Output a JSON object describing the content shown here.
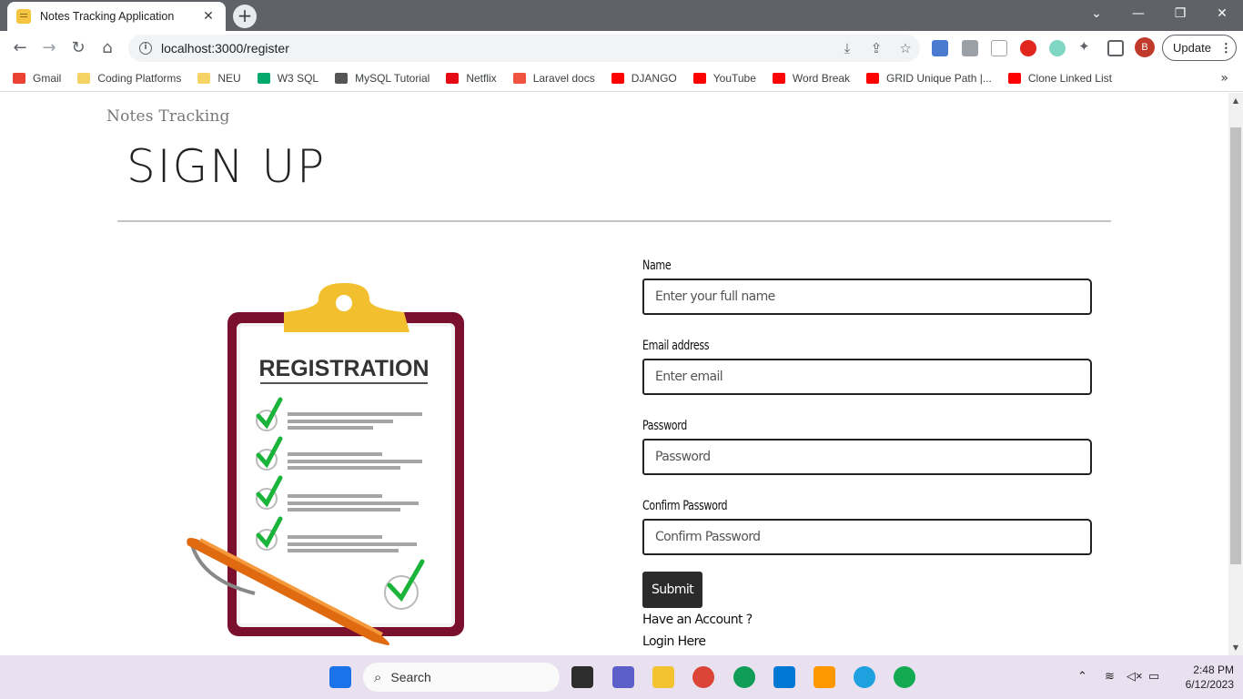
{
  "browser": {
    "tab_title": "Notes Tracking Application",
    "tab_close": "✕",
    "new_tab": "+",
    "url": "localhost:3000/register",
    "update_label": "Update",
    "profile_initial": "B",
    "bookmarks": [
      {
        "label": "Gmail",
        "icon": "gmail-icon",
        "color": "#ea4335"
      },
      {
        "label": "Coding Platforms",
        "icon": "folder-icon",
        "color": "#f6d365"
      },
      {
        "label": "NEU",
        "icon": "folder-icon",
        "color": "#f6d365"
      },
      {
        "label": "W3 SQL",
        "icon": "w3schools-icon",
        "color": "#04aa6d"
      },
      {
        "label": "MySQL Tutorial",
        "icon": "mysql-icon",
        "color": "#555555"
      },
      {
        "label": "Netflix",
        "icon": "netflix-icon",
        "color": "#e50914"
      },
      {
        "label": "Laravel docs",
        "icon": "laravel-icon",
        "color": "#f05340"
      },
      {
        "label": "DJANGO",
        "icon": "youtube-icon",
        "color": "#ff0000"
      },
      {
        "label": "YouTube",
        "icon": "youtube-icon",
        "color": "#ff0000"
      },
      {
        "label": "Word Break",
        "icon": "youtube-icon",
        "color": "#ff0000"
      },
      {
        "label": "GRID Unique Path |...",
        "icon": "youtube-icon",
        "color": "#ff0000"
      },
      {
        "label": "Clone Linked List",
        "icon": "youtube-icon",
        "color": "#ff0000"
      }
    ]
  },
  "page": {
    "brand": "Notes Tracking",
    "heading": "SIGN UP",
    "illustration_text": "REGISTRATION",
    "form": {
      "name_label": "Name",
      "name_placeholder": "Enter your full name",
      "email_label": "Email address",
      "email_placeholder": "Enter email",
      "password_label": "Password",
      "password_placeholder": "Password",
      "confirm_label": "Confirm Password",
      "confirm_placeholder": "Confirm Password",
      "submit_label": "Submit",
      "have_account": "Have an Account ?",
      "login_link": "Login Here"
    }
  },
  "taskbar": {
    "search_label": "Search",
    "time": "2:48 PM",
    "date": "6/12/2023"
  }
}
